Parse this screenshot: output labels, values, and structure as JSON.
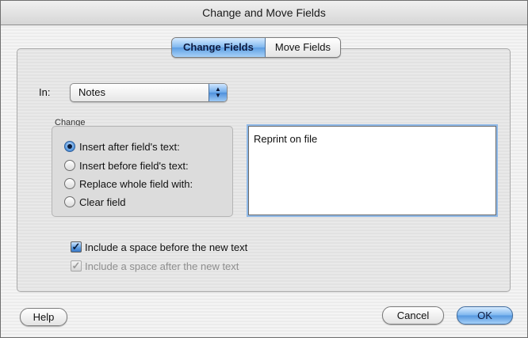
{
  "window": {
    "title": "Change and Move Fields"
  },
  "tabs": [
    {
      "label": "Change Fields",
      "selected": true
    },
    {
      "label": "Move Fields",
      "selected": false
    }
  ],
  "field_popup": {
    "label": "In:",
    "value": "Notes"
  },
  "change_group": {
    "label": "Change",
    "options": [
      {
        "label": "Insert after field's text:",
        "selected": true
      },
      {
        "label": "Insert before field's text:",
        "selected": false
      },
      {
        "label": "Replace whole field with:",
        "selected": false
      },
      {
        "label": "Clear field",
        "selected": false
      }
    ]
  },
  "text_value": "Reprint on file",
  "checkboxes": [
    {
      "label": "Include a space before the new text",
      "checked": true,
      "enabled": true
    },
    {
      "label": "Include a space after the new text",
      "checked": true,
      "enabled": false
    }
  ],
  "buttons": {
    "help": "Help",
    "cancel": "Cancel",
    "ok": "OK"
  },
  "colors": {
    "accent_blue": "#5e9fe3",
    "focus_ring": "#8fb9e8"
  }
}
